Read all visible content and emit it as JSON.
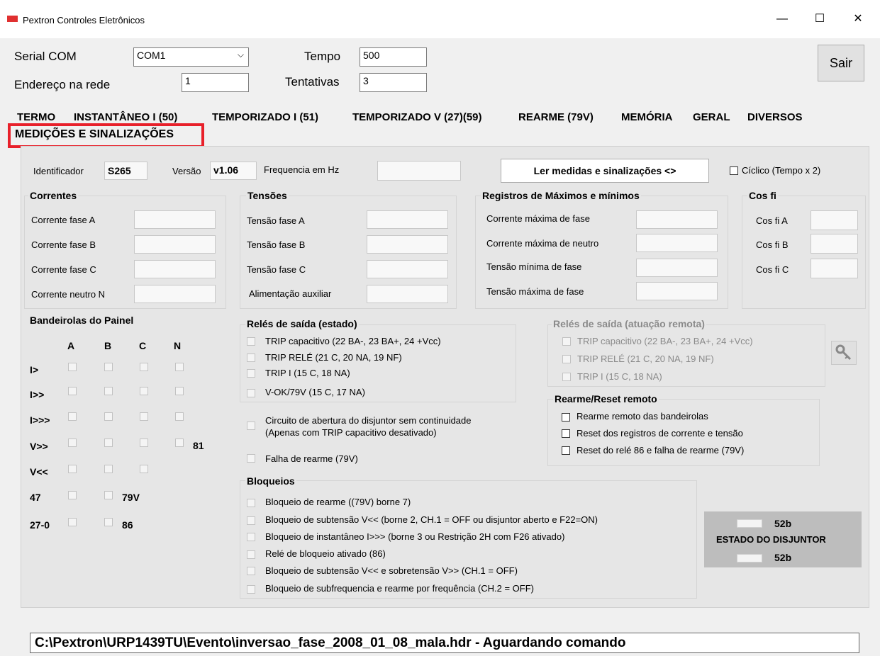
{
  "window": {
    "title": "Pextron Controles Eletrônicos",
    "minimize": "—",
    "maximize": "☐",
    "close": "✕"
  },
  "header": {
    "serial_label": "Serial COM",
    "serial_value": "COM1",
    "endereco_label": "Endereço na rede",
    "endereco_value": "1",
    "tempo_label": "Tempo",
    "tempo_value": "500",
    "tentativas_label": "Tentativas",
    "tentativas_value": "3",
    "sair_label": "Sair"
  },
  "tabs": [
    "TERMO",
    "INSTANTÂNEO I (50)",
    "TEMPORIZADO I (51)",
    "TEMPORIZADO V (27)(59)",
    "REARME (79V)",
    "MEMÓRIA",
    "GERAL",
    "DIVERSOS",
    "MEDIÇÕES E SINALIZAÇÕES"
  ],
  "highlight_color": "#e8202a",
  "info": {
    "identificador_label": "Identificador",
    "identificador_value": "S265",
    "versao_label": "Versão",
    "versao_value": "v1.06",
    "frequencia_label": "Frequencia em Hz",
    "ler_button": "Ler medidas e sinalizações <>",
    "ciclico_label": "Cíclico (Tempo x 2)"
  },
  "correntes": {
    "title": "Correntes",
    "rows": [
      "Corrente fase A",
      "Corrente fase B",
      "Corrente fase C",
      "Corrente neutro N"
    ]
  },
  "tensoes": {
    "title": "Tensões",
    "rows": [
      "Tensão fase A",
      "Tensão fase B",
      "Tensão fase C",
      "Alimentação auxiliar"
    ]
  },
  "registros": {
    "title": "Registros de Máximos e mínimos",
    "rows": [
      "Corrente máxima de fase",
      "Corrente máxima de neutro",
      "Tensão mínima de fase",
      "Tensão máxima de fase"
    ]
  },
  "cosfi": {
    "title": "Cos fi",
    "rows": [
      "Cos fi A",
      "Cos fi B",
      "Cos fi C"
    ]
  },
  "bandeirolas": {
    "title": "Bandeirolas do Painel",
    "cols": [
      "A",
      "B",
      "C",
      "N"
    ],
    "rows": [
      "I>",
      "I>>",
      "I>>>",
      "V>>",
      "V<<",
      "47",
      "27-0"
    ],
    "extra_81": "81",
    "extra_79v": "79V",
    "extra_86": "86"
  },
  "reles_estado": {
    "title": "Relés de saída (estado)",
    "items": [
      "TRIP capacitivo (22 BA-, 23 BA+, 24 +Vcc)",
      "TRIP RELÉ (21 C, 20 NA, 19 NF)",
      "TRIP I (15 C, 18 NA)",
      "V-OK/79V (15 C, 17 NA)"
    ],
    "circuito_1": "Circuito de abertura do disjuntor sem continuidade",
    "circuito_2": "(Apenas com TRIP capacitivo desativado)",
    "falha": "Falha de rearme (79V)"
  },
  "reles_remota": {
    "title": "Relés de saída (atuação remota)",
    "items": [
      "TRIP capacitivo (22 BA-, 23 BA+, 24 +Vcc)",
      "TRIP RELÉ (21 C, 20 NA, 19 NF)",
      "TRIP I (15 C, 18 NA)"
    ]
  },
  "rearme": {
    "title": "Rearme/Reset remoto",
    "items": [
      "Rearme remoto das bandeirolas",
      "Reset dos registros de corrente e tensão",
      "Reset do relé 86 e falha de rearme (79V)"
    ]
  },
  "bloqueios": {
    "title": "Bloqueios",
    "items": [
      "Bloqueio de rearme ((79V) borne 7)",
      "Bloqueio de subtensão V<< (borne 2, CH.1 = OFF ou disjuntor aberto e F22=ON)",
      "Bloqueio de instantâneo I>>> (borne 3 ou Restrição 2H com F26 ativado)",
      "Relé de bloqueio ativado (86)",
      "Bloqueio de subtensão V<< e sobretensão V>> (CH.1 = OFF)",
      "Bloqueio de subfrequencia e rearme por frequência (CH.2 = OFF)"
    ]
  },
  "estado": {
    "top": "52b",
    "title": "ESTADO DO DISJUNTOR",
    "bottom": "52b"
  },
  "status_bar": "C:\\Pextron\\URP1439TU\\Evento\\inversao_fase_2008_01_08_mala.hdr - Aguardando comando"
}
